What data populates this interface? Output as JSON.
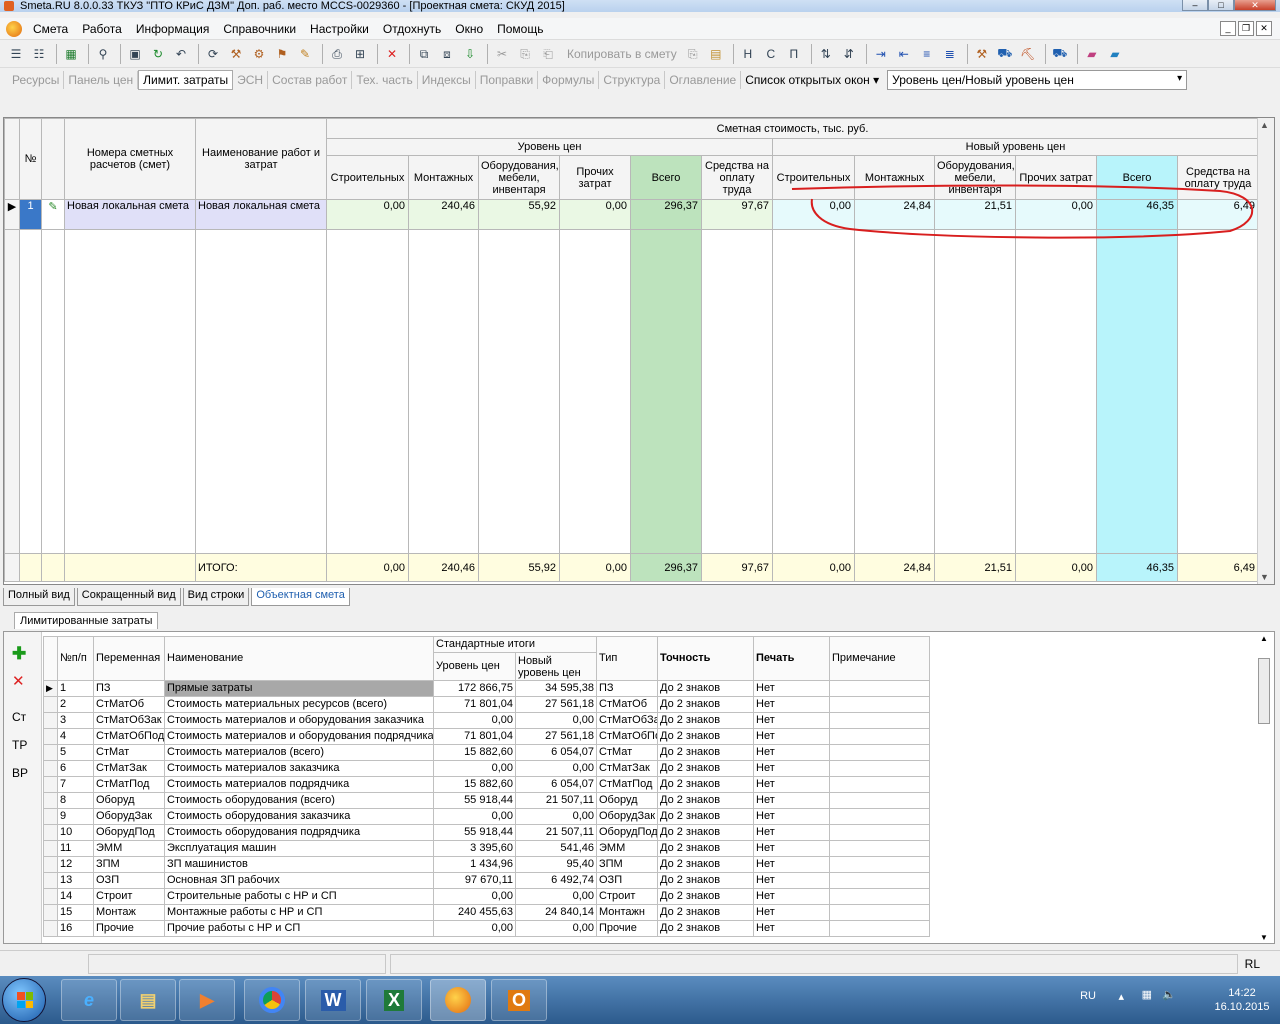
{
  "window": {
    "title": "Smeta.RU  8.0.0.33  ТКУЗ \"ПТО КРиС ДЗМ\"  Доп. раб. место  MCCS-0029360 - [Проектная смета: СКУД 2015]"
  },
  "menu": [
    "Смета",
    "Работа",
    "Информация",
    "Справочники",
    "Настройки",
    "Отдохнуть",
    "Окно",
    "Помощь"
  ],
  "toolbar": {
    "copy_label": "Копировать в смету"
  },
  "tabs": {
    "items": [
      "Ресурсы",
      "Панель цен",
      "Лимит. затраты",
      "ЭСН",
      "Состав работ",
      "Тех. часть",
      "Индексы",
      "Поправки",
      "Формулы",
      "Структура",
      "Оглавление"
    ],
    "active": "Лимит. затраты",
    "open_windows": "Список открытых окон",
    "price_level_combo": "Уровень цен/Новый уровень цен"
  },
  "grid": {
    "headers": {
      "num": "№",
      "estimate_numbers": "Номера сметных расчетов (смет)",
      "work_name": "Наименование работ и затрат",
      "cost_group": "Сметная стоимость, тыс. руб.",
      "level": "Уровень цен",
      "new_level": "Новый уровень цен",
      "construction": "Строительных",
      "installation": "Монтажных",
      "equipment": "Оборудования, мебели, инвентаря",
      "other": "Прочих затрат",
      "total": "Всего",
      "wages": "Средства на оплату труда"
    },
    "row": {
      "num": "1",
      "estimate": "Новая локальная смета",
      "name": "Новая локальная смета",
      "level": [
        "0,00",
        "240,46",
        "55,92",
        "0,00",
        "296,37",
        "97,67"
      ],
      "new_level": [
        "0,00",
        "24,84",
        "21,51",
        "0,00",
        "46,35",
        "6,49"
      ]
    },
    "itogo": {
      "label": "ИТОГО:",
      "level": [
        "0,00",
        "240,46",
        "55,92",
        "0,00",
        "296,37",
        "97,67"
      ],
      "new_level": [
        "0,00",
        "24,84",
        "21,51",
        "0,00",
        "46,35",
        "6,49"
      ]
    }
  },
  "view_tabs": [
    "Полный вид",
    "Сокращенный вид",
    "Вид строки",
    "Объектная смета"
  ],
  "lower": {
    "section_tab": "Лимитированные затраты",
    "side": [
      "Ст",
      "ТР",
      "ВР"
    ],
    "headers": {
      "num": "№п/п",
      "variable": "Переменная",
      "name": "Наименование",
      "std_totals": "Стандартные итоги",
      "level": "Уровень цен",
      "new_level": "Новый уровень цен",
      "type": "Тип",
      "precision": "Точность",
      "print": "Печать",
      "note": "Примечание"
    },
    "rows": [
      [
        "1",
        "ПЗ",
        "Прямые затраты",
        "172 866,75",
        "34 595,38",
        "ПЗ",
        "До 2 знаков",
        "Нет",
        ""
      ],
      [
        "2",
        "СтМатОб",
        "Стоимость материальных ресурсов (всего)",
        "71 801,04",
        "27 561,18",
        "СтМатОб",
        "До 2 знаков",
        "Нет",
        ""
      ],
      [
        "3",
        "СтМатОбЗак",
        "Стоимость материалов и оборудования заказчика",
        "0,00",
        "0,00",
        "СтМатОбЗа",
        "До 2 знаков",
        "Нет",
        ""
      ],
      [
        "4",
        "СтМатОбПод",
        "Стоимость материалов и оборудования подрядчика",
        "71 801,04",
        "27 561,18",
        "СтМатОбПо",
        "До 2 знаков",
        "Нет",
        ""
      ],
      [
        "5",
        "СтМат",
        "Стоимость материалов (всего)",
        "15 882,60",
        "6 054,07",
        "СтМат",
        "До 2 знаков",
        "Нет",
        ""
      ],
      [
        "6",
        "СтМатЗак",
        "Стоимость материалов заказчика",
        "0,00",
        "0,00",
        "СтМатЗак",
        "До 2 знаков",
        "Нет",
        ""
      ],
      [
        "7",
        "СтМатПод",
        "Стоимость материалов подрядчика",
        "15 882,60",
        "6 054,07",
        "СтМатПод",
        "До 2 знаков",
        "Нет",
        ""
      ],
      [
        "8",
        "Оборуд",
        "Стоимость оборудования (всего)",
        "55 918,44",
        "21 507,11",
        "Оборуд",
        "До 2 знаков",
        "Нет",
        ""
      ],
      [
        "9",
        "ОборудЗак",
        "Стоимость оборудования заказчика",
        "0,00",
        "0,00",
        "ОборудЗак",
        "До 2 знаков",
        "Нет",
        ""
      ],
      [
        "10",
        "ОборудПод",
        "Стоимость оборудования подрядчика",
        "55 918,44",
        "21 507,11",
        "ОборудПод",
        "До 2 знаков",
        "Нет",
        ""
      ],
      [
        "11",
        "ЭММ",
        "Эксплуатация машин",
        "3 395,60",
        "541,46",
        "ЭММ",
        "До 2 знаков",
        "Нет",
        ""
      ],
      [
        "12",
        "ЗПМ",
        "ЗП машинистов",
        "1 434,96",
        "95,40",
        "ЗПМ",
        "До 2 знаков",
        "Нет",
        ""
      ],
      [
        "13",
        "ОЗП",
        "Основная ЗП рабочих",
        "97 670,11",
        "6 492,74",
        "ОЗП",
        "До 2 знаков",
        "Нет",
        ""
      ],
      [
        "14",
        "Строит",
        "Строительные работы с НР и СП",
        "0,00",
        "0,00",
        "Строит",
        "До 2 знаков",
        "Нет",
        ""
      ],
      [
        "15",
        "Монтаж",
        "Монтажные работы с НР и СП",
        "240 455,63",
        "24 840,14",
        "Монтажн",
        "До 2 знаков",
        "Нет",
        ""
      ],
      [
        "16",
        "Прочие",
        "Прочие работы с НР и СП",
        "0,00",
        "0,00",
        "Прочие",
        "До 2 знаков",
        "Нет",
        ""
      ]
    ]
  },
  "status": {
    "layout": "RL"
  },
  "taskbar": {
    "lang": "RU",
    "time": "14:22",
    "date": "16.10.2015"
  },
  "colors": {
    "total_col_level": "#bde3bd",
    "total_col_new": "#b8f4fb",
    "annotation": "#d81e1e"
  }
}
